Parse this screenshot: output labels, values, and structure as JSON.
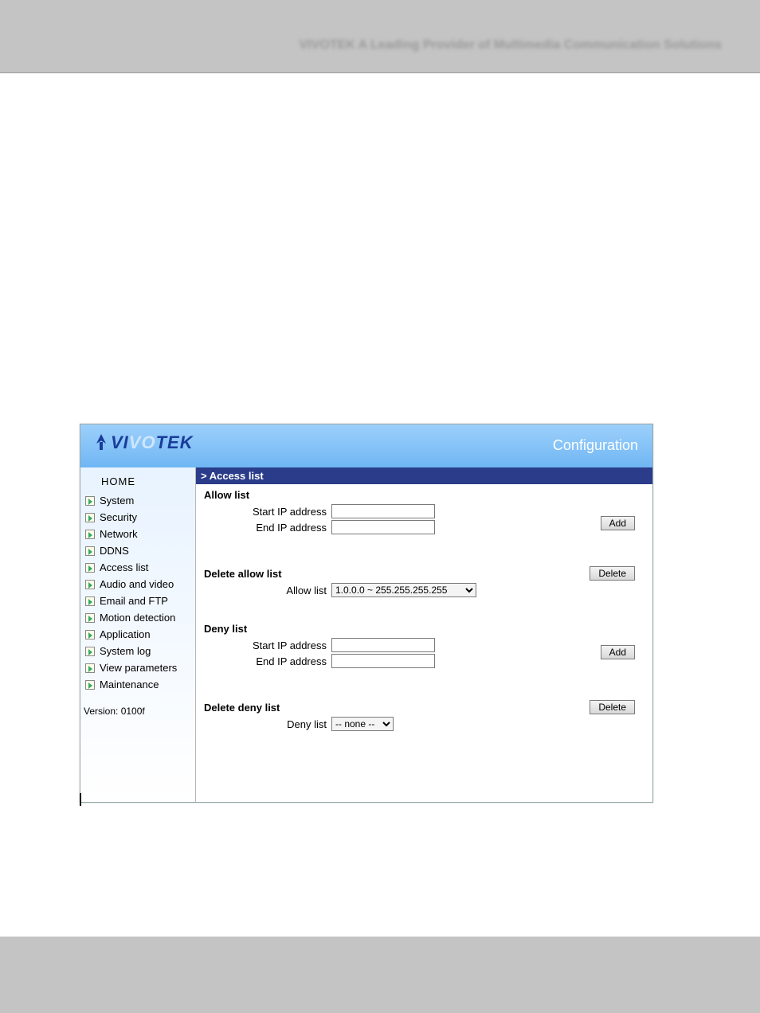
{
  "doc_header_blurred": "VIVOTEK   A Leading Provider of Multimedia Communication Solutions",
  "logo_text": {
    "p1": "VI",
    "p2": "VO",
    "p3": "TEK"
  },
  "page_title": "Configuration",
  "breadcrumb": "> Access list",
  "sidebar": {
    "home": "HOME",
    "items": [
      "System",
      "Security",
      "Network",
      "DDNS",
      "Access list",
      "Audio and video",
      "Email and FTP",
      "Motion detection",
      "Application",
      "System log",
      "View parameters",
      "Maintenance"
    ],
    "version": "Version: 0100f"
  },
  "sections": {
    "allow": {
      "title": "Allow list",
      "start_label": "Start IP address",
      "end_label": "End IP address",
      "start_value": "",
      "end_value": "",
      "button": "Add"
    },
    "delete_allow": {
      "title": "Delete allow list",
      "select_label": "Allow list",
      "select_value": "1.0.0.0 ~ 255.255.255.255",
      "button": "Delete"
    },
    "deny": {
      "title": "Deny list",
      "start_label": "Start IP address",
      "end_label": "End IP address",
      "start_value": "",
      "end_value": "",
      "button": "Add"
    },
    "delete_deny": {
      "title": "Delete deny list",
      "select_label": "Deny list",
      "select_value": "-- none --",
      "button": "Delete"
    }
  }
}
